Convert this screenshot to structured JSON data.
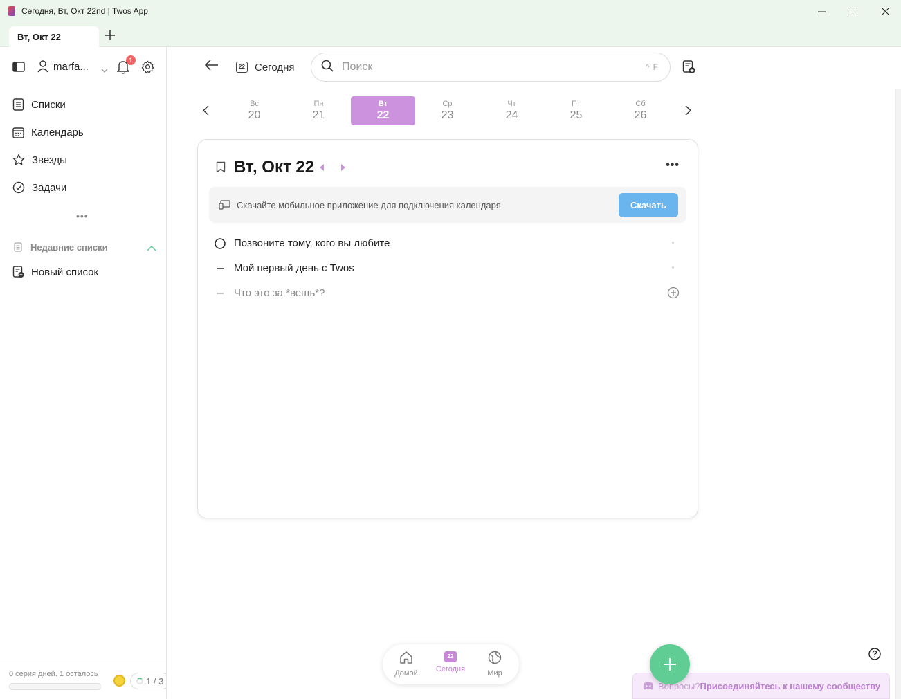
{
  "window": {
    "title": "Сегодня, Вт, Окт 22nd | Twos App",
    "tab_label": "Вт, Окт 22"
  },
  "sidebar": {
    "user_name": "marfa...",
    "notification_count": "1",
    "nav": [
      {
        "label": "Списки",
        "icon": "list-icon"
      },
      {
        "label": "Календарь",
        "icon": "calendar-icon"
      },
      {
        "label": "Звезды",
        "icon": "star-icon"
      },
      {
        "label": "Задачи",
        "icon": "check-circle-icon"
      }
    ],
    "more": "•••",
    "recent_header": "Недавние списки",
    "new_list_label": "Новый список",
    "streak_text": "0 серия дней. 1 осталось",
    "goal": "1 / 3"
  },
  "toolbar": {
    "today_label": "Сегодня",
    "today_icon_day": "22",
    "search_placeholder": "Поиск",
    "search_shortcut": "^ F"
  },
  "week": [
    {
      "name": "Вс",
      "date": "20",
      "active": false
    },
    {
      "name": "Пн",
      "date": "21",
      "active": false
    },
    {
      "name": "Вт",
      "date": "22",
      "active": true
    },
    {
      "name": "Ср",
      "date": "23",
      "active": false
    },
    {
      "name": "Чт",
      "date": "24",
      "active": false
    },
    {
      "name": "Пт",
      "date": "25",
      "active": false
    },
    {
      "name": "Сб",
      "date": "26",
      "active": false
    }
  ],
  "card": {
    "title": "Вт, Окт 22",
    "banner_text": "Скачайте мобильное приложение для подключения календаря",
    "download_label": "Скачать",
    "tasks": [
      {
        "text": "Позвоните тому, кого вы любите",
        "type": "todo"
      },
      {
        "text": "Мой первый день с Twos",
        "type": "note"
      }
    ],
    "placeholder": "Что это за *вещь*?"
  },
  "bottom_nav": {
    "home_label": "Домой",
    "today_label": "Сегодня",
    "today_day": "22",
    "world_label": "Мир"
  },
  "community": {
    "question": "Вопросы?",
    "link": "Присоединяйтесь к нашему сообществу"
  },
  "colors": {
    "accent_purple": "#cd92dd",
    "download_blue": "#6ab5ee",
    "fab_green": "#5fcd94",
    "badge_red": "#f06363"
  }
}
